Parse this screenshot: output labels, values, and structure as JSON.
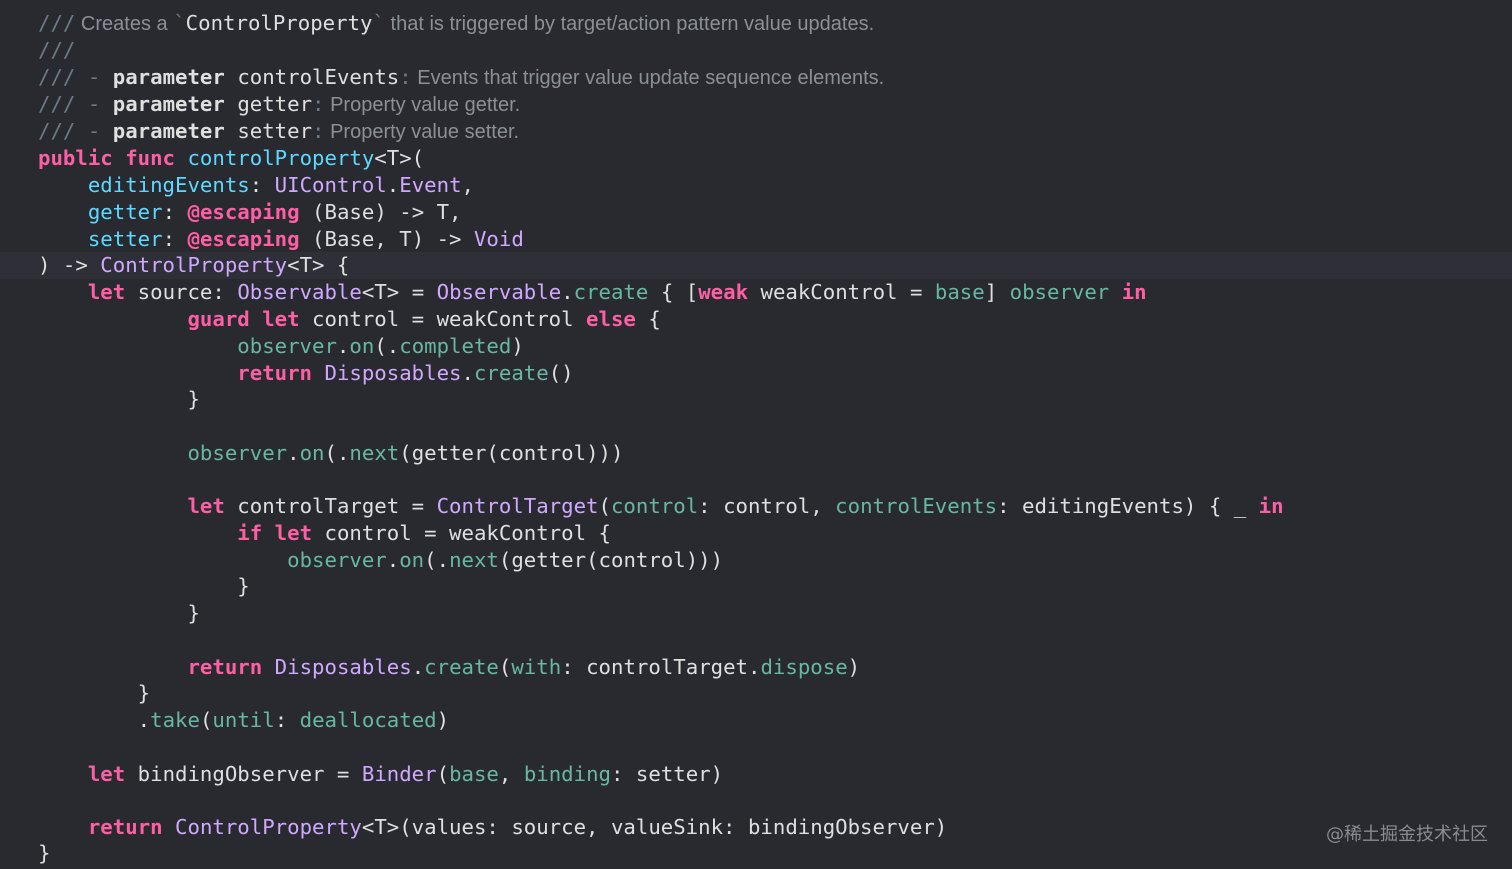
{
  "editor": {
    "background": "#292a30",
    "colors": {
      "comment": "#6c7986",
      "keyword": "#fc5fa3",
      "declaration": "#5dd8ff",
      "type": "#d0a8ff",
      "member": "#67b7a4",
      "plain": "#dfdfe0"
    }
  },
  "code": {
    "l1": {
      "slash": "///",
      "a": " Creates a ",
      "tick1": "`",
      "name": "ControlProperty",
      "tick2": "`",
      "b": " that is triggered by target/action pattern value updates."
    },
    "l2": {
      "slash": "///"
    },
    "l3": {
      "slash": "///",
      "dash": " - ",
      "kw": "parameter",
      "name": " controlEvents",
      "colon": ":",
      "desc": " Events that trigger value update sequence elements."
    },
    "l4": {
      "slash": "///",
      "dash": " - ",
      "kw": "parameter",
      "name": " getter",
      "colon": ":",
      "desc": " Property value getter."
    },
    "l5": {
      "slash": "///",
      "dash": " - ",
      "kw": "parameter",
      "name": " setter",
      "colon": ":",
      "desc": " Property value setter."
    },
    "l6": {
      "kw1": "public",
      "kw2": " func",
      "fn": " controlProperty",
      "rest": "<T>("
    },
    "l7": {
      "indent": "    ",
      "param": "editingEvents",
      "colon": ": ",
      "t1": "UIControl",
      "dot": ".",
      "t2": "Event",
      "rest": ","
    },
    "l8": {
      "indent": "    ",
      "param": "getter",
      "colon": ": ",
      "attr": "@escaping",
      "rest": " (Base) -> T,"
    },
    "l9": {
      "indent": "    ",
      "param": "setter",
      "colon": ": ",
      "attr": "@escaping",
      "rest": " (Base, T) -> ",
      "t": "Void"
    },
    "l10": {
      "a": ") -> ",
      "t": "ControlProperty",
      "rest": "<T> {"
    },
    "l11": {
      "indent": "    ",
      "kw": "let",
      "a": " source: ",
      "t1": "Observable",
      "b": "<T> = ",
      "t2": "Observable",
      "dot": ".",
      "m": "create",
      "c": " { [",
      "kw2": "weak",
      "d": " weakControl = ",
      "m2": "base",
      "e": "] ",
      "m3": "observer",
      "kw3": " in"
    },
    "l12": {
      "indent": "            ",
      "kw": "guard",
      "kw2": " let",
      "a": " control = weakControl ",
      "kw3": "else",
      "b": " {"
    },
    "l13": {
      "indent": "                ",
      "m": "observer",
      "dot": ".",
      "m2": "on",
      "a": "(.",
      "m3": "completed",
      "b": ")"
    },
    "l14": {
      "indent": "                ",
      "kw": "return",
      "a": " ",
      "t": "Disposables",
      "dot": ".",
      "m": "create",
      "b": "()"
    },
    "l15": {
      "indent": "            ",
      "a": "}"
    },
    "l17": {
      "indent": "            ",
      "m": "observer",
      "dot": ".",
      "m2": "on",
      "a": "(.",
      "m3": "next",
      "b": "(getter(control)))"
    },
    "l19": {
      "indent": "            ",
      "kw": "let",
      "a": " controlTarget = ",
      "t": "ControlTarget",
      "b": "(",
      "m": "control",
      "c": ": control, ",
      "m2": "controlEvents",
      "d": ": editingEvents) { _ ",
      "kw2": "in"
    },
    "l20": {
      "indent": "                ",
      "kw": "if",
      "kw2": " let",
      "a": " control = weakControl {"
    },
    "l21": {
      "indent": "                    ",
      "m": "observer",
      "dot": ".",
      "m2": "on",
      "a": "(.",
      "m3": "next",
      "b": "(getter(control)))"
    },
    "l22": {
      "indent": "                ",
      "a": "}"
    },
    "l23": {
      "indent": "            ",
      "a": "}"
    },
    "l25": {
      "indent": "            ",
      "kw": "return",
      "a": " ",
      "t": "Disposables",
      "dot": ".",
      "m": "create",
      "b": "(",
      "m2": "with",
      "c": ": controlTarget.",
      "m3": "dispose",
      "d": ")"
    },
    "l26": {
      "indent": "        ",
      "a": "}"
    },
    "l27": {
      "indent": "        ",
      "a": ".",
      "m": "take",
      "b": "(",
      "m2": "until",
      "c": ": ",
      "m3": "deallocated",
      "d": ")"
    },
    "l29": {
      "indent": "    ",
      "kw": "let",
      "a": " bindingObserver = ",
      "t": "Binder",
      "b": "(",
      "m": "base",
      "c": ", ",
      "m2": "binding",
      "d": ": setter)"
    },
    "l31": {
      "indent": "    ",
      "kw": "return",
      "a": " ",
      "t": "ControlProperty",
      "b": "<T>(values: source, valueSink: bindingObserver)"
    },
    "l32": {
      "a": "}"
    }
  },
  "watermark": "@稀土掘金技术社区"
}
